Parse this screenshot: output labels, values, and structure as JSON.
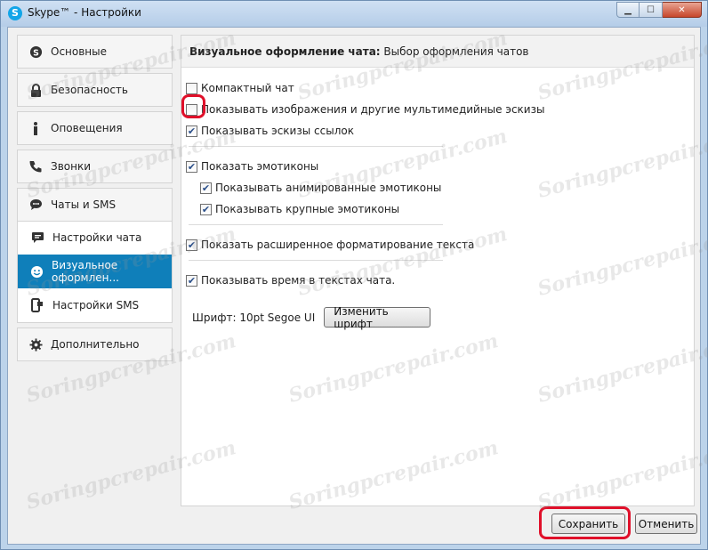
{
  "window": {
    "title": "Skype™ - Настройки",
    "app_icon": "S"
  },
  "sidebar": {
    "items": [
      {
        "label": "Основные",
        "icon": "skype-icon"
      },
      {
        "label": "Безопасность",
        "icon": "lock-icon"
      },
      {
        "label": "Оповещения",
        "icon": "info-icon"
      },
      {
        "label": "Звонки",
        "icon": "phone-icon"
      },
      {
        "label": "Чаты и SMS",
        "icon": "chat-bubble-icon"
      }
    ],
    "subitems": [
      {
        "label": "Настройки чата",
        "icon": "chat-icon"
      },
      {
        "label": "Визуальное оформлен...",
        "icon": "smiley-icon",
        "active": true
      },
      {
        "label": "Настройки SMS",
        "icon": "sms-icon"
      }
    ],
    "advanced": {
      "label": "Дополнительно",
      "icon": "gear-icon"
    }
  },
  "panel": {
    "header_bold": "Визуальное оформление чата:",
    "header_rest": " Выбор оформления чатов",
    "options": {
      "compact": {
        "label": "Компактный чат",
        "checked": false
      },
      "show_images": {
        "label": "Показывать изображения и другие мультимедийные эскизы",
        "checked": false
      },
      "link_previews": {
        "label": "Показывать эскизы ссылок",
        "checked": true
      },
      "emoticons": {
        "label": "Показать эмотиконы",
        "checked": true
      },
      "animated_emoticons": {
        "label": "Показывать анимированные эмотиконы",
        "checked": true
      },
      "large_emoticons": {
        "label": "Показывать крупные эмотиконы",
        "checked": true
      },
      "formatting": {
        "label": "Показать расширенное форматирование текста",
        "checked": true
      },
      "timestamps": {
        "label": "Показывать время в текстах чата.",
        "checked": true
      }
    },
    "font_label": "Шрифт: 10pt Segoe UI",
    "change_font": "Изменить шрифт"
  },
  "footer": {
    "save": "Сохранить",
    "cancel": "Отменить"
  },
  "watermark": "Soringpcrepair.com",
  "colors": {
    "active_item": "#0f7fba",
    "highlight": "#e0102a",
    "checkmark": "#2b4f8a"
  }
}
